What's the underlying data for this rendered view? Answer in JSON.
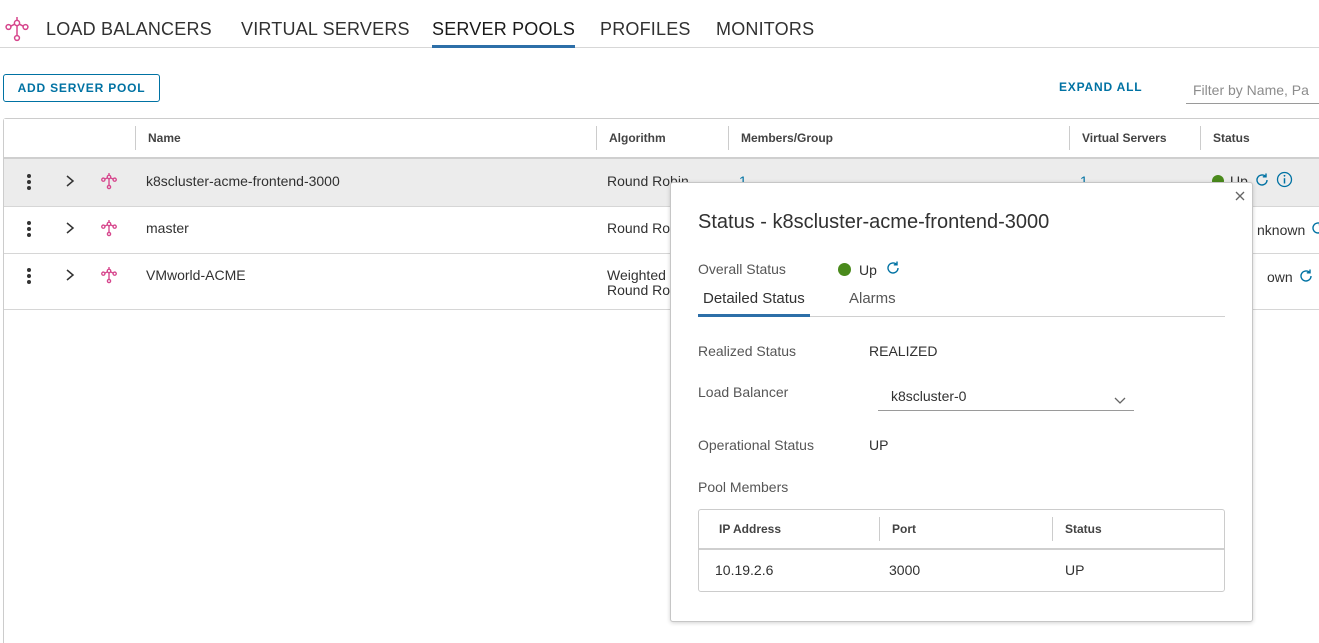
{
  "nav": {
    "logo_icon": "load-balancer-icon",
    "tabs": [
      {
        "label": "LOAD BALANCERS",
        "active": false
      },
      {
        "label": "VIRTUAL SERVERS",
        "active": false
      },
      {
        "label": "SERVER POOLS",
        "active": true
      },
      {
        "label": "PROFILES",
        "active": false
      },
      {
        "label": "MONITORS",
        "active": false
      }
    ]
  },
  "toolbar": {
    "add_label": "ADD SERVER POOL",
    "expand_all_label": "EXPAND ALL",
    "filter_placeholder": "Filter by Name, Pa"
  },
  "grid": {
    "columns": [
      "Name",
      "Algorithm",
      "Members/Group",
      "Virtual Servers",
      "Status"
    ],
    "rows": [
      {
        "name": "k8scluster-acme-frontend-3000",
        "algorithm": "Round Robin",
        "algorithm_visible": "Round Robin",
        "members": "1",
        "virtual_servers": "1",
        "status": "Up",
        "selected": true
      },
      {
        "name": "master",
        "algorithm_visible": "Round Ro",
        "status_visible": "nknown"
      },
      {
        "name": "VMworld-ACME",
        "algorithm_line1": "Weighted",
        "algorithm_line2": "Round Ro",
        "status_visible": "own"
      }
    ]
  },
  "popover": {
    "title": "Status - k8scluster-acme-frontend-3000",
    "overall_status_label": "Overall Status",
    "overall_status_value": "Up",
    "tabs": [
      {
        "label": "Detailed Status",
        "active": true
      },
      {
        "label": "Alarms",
        "active": false
      }
    ],
    "realized_status_label": "Realized Status",
    "realized_status_value": "REALIZED",
    "load_balancer_label": "Load Balancer",
    "load_balancer_value": "k8scluster-0",
    "operational_status_label": "Operational Status",
    "operational_status_value": "UP",
    "pool_members_label": "Pool Members",
    "members_table": {
      "headers": [
        "IP Address",
        "Port",
        "Status"
      ],
      "rows": [
        {
          "ip": "10.19.2.6",
          "port": "3000",
          "status": "UP"
        }
      ]
    }
  },
  "colors": {
    "accent": "#0072a3",
    "active_tab_underline": "#2d6fa8",
    "status_up": "#4a8a1c",
    "pool_icon": "#d6458c"
  }
}
